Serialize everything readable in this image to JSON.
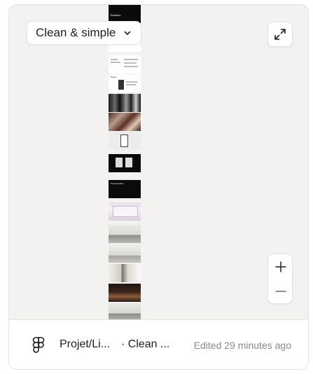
{
  "view_selector": {
    "label": "Clean & simple",
    "icon": "chevron-down-icon"
  },
  "toolbar": {
    "expand_icon": "expand-icon",
    "zoom_in_icon": "plus-icon",
    "zoom_out_icon": "minus-icon"
  },
  "filmstrip": {
    "slides": [
      {
        "title": "Elastom"
      },
      {
        "title": ""
      },
      {
        "title": ""
      },
      {
        "title": "Projet"
      },
      {
        "title": ""
      },
      {
        "title": ""
      },
      {
        "title": ""
      },
      {
        "title": ""
      },
      {
        "title": "Scénographie"
      },
      {
        "title": ""
      },
      {
        "title": ""
      },
      {
        "title": ""
      },
      {
        "title": ""
      },
      {
        "title": ""
      },
      {
        "title": ""
      },
      {
        "title": ""
      }
    ]
  },
  "footer": {
    "app_icon": "figma-logo-icon",
    "file_name": "Projet/Li...",
    "page_name": "· Clean ...",
    "edited": "Edited 29 minutes ago"
  },
  "colors": {
    "canvas_bg": "#f3f2f0",
    "text_primary": "#1e1e1e",
    "text_muted": "#8a8a8a"
  }
}
